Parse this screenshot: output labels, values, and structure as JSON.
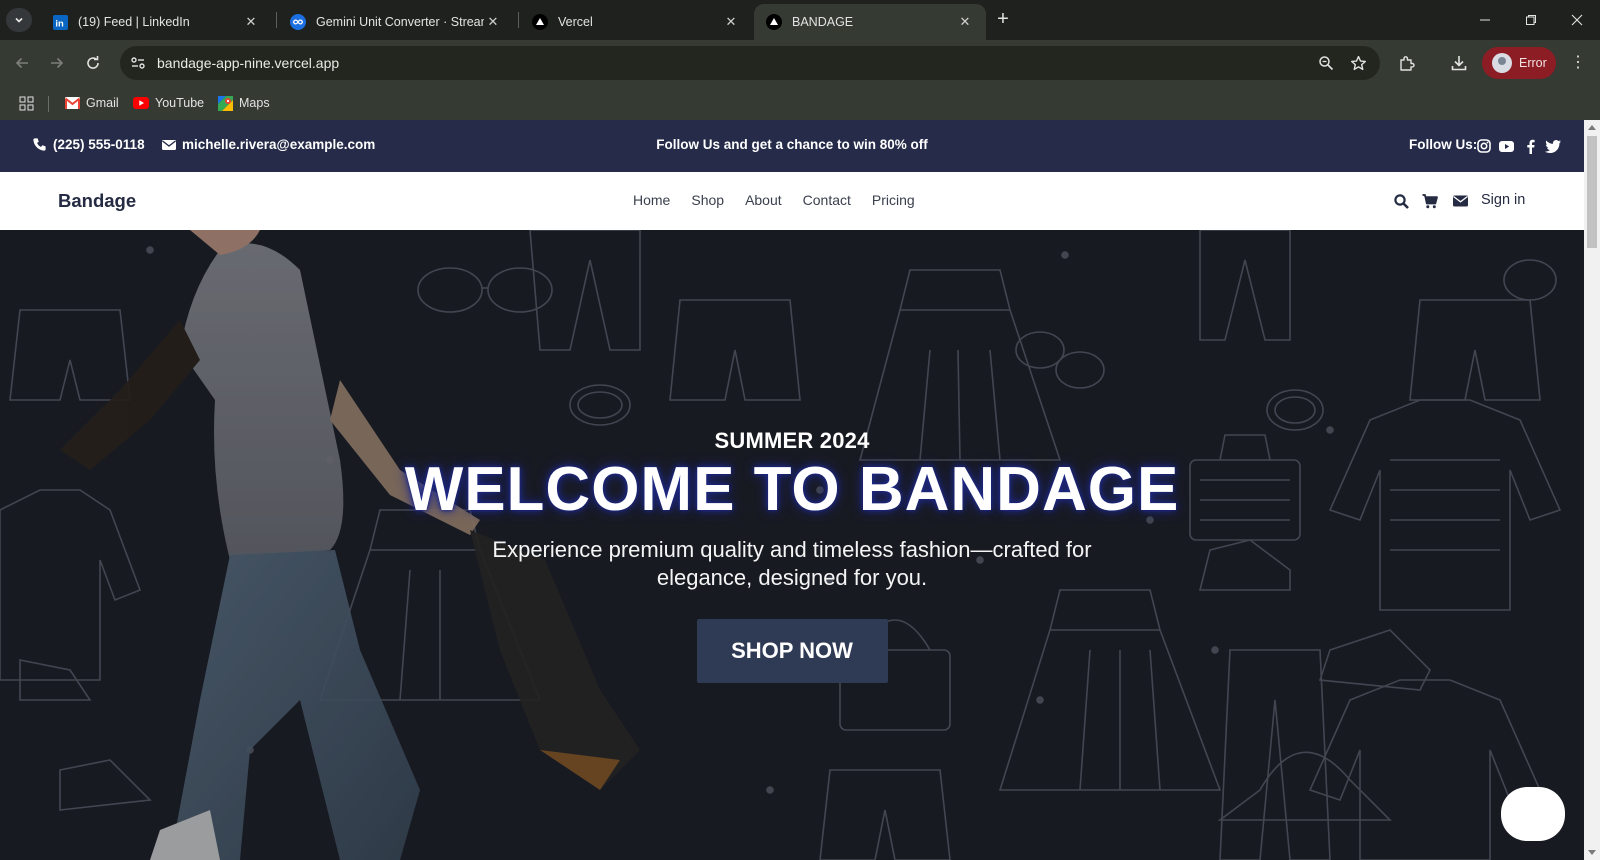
{
  "browser": {
    "tabs": [
      {
        "title": "(19) Feed | LinkedIn",
        "icon": "linkedin-icon",
        "active": false
      },
      {
        "title": "Gemini Unit Converter · Streamlit",
        "icon": "streamlit-icon",
        "active": false
      },
      {
        "title": "Vercel",
        "icon": "vercel-icon",
        "active": false
      },
      {
        "title": "BANDAGE",
        "icon": "vercel-icon",
        "active": true
      }
    ],
    "url": "bandage-app-nine.vercel.app",
    "profile_label": "Error",
    "bookmarks": [
      {
        "label": "Gmail",
        "icon": "gmail-icon"
      },
      {
        "label": "YouTube",
        "icon": "youtube-icon"
      },
      {
        "label": "Maps",
        "icon": "maps-icon"
      }
    ]
  },
  "site": {
    "topbar": {
      "phone": "(225) 555-0118",
      "email": "michelle.rivera@example.com",
      "promo": "Follow Us and get a chance to win 80% off",
      "follow_label": "Follow Us:",
      "social_icons": [
        "instagram-icon",
        "youtube-icon",
        "facebook-icon",
        "twitter-icon"
      ]
    },
    "nav": {
      "logo": "Bandage",
      "links": [
        "Home",
        "Shop",
        "About",
        "Contact",
        "Pricing"
      ],
      "icons": [
        "search-icon",
        "cart-icon",
        "mail-icon"
      ],
      "signin": "Sign in"
    },
    "hero": {
      "subtitle": "SUMMER 2024",
      "title": "WELCOME TO BANDAGE",
      "description": "Experience premium quality and timeless fashion—crafted for elegance, designed for you.",
      "cta": "SHOP NOW"
    }
  },
  "colors": {
    "topbar_bg": "#252b48",
    "nav_bg": "#ffffff",
    "cta_bg": "#2f3a55",
    "profile_pill": "#8c1d24"
  }
}
